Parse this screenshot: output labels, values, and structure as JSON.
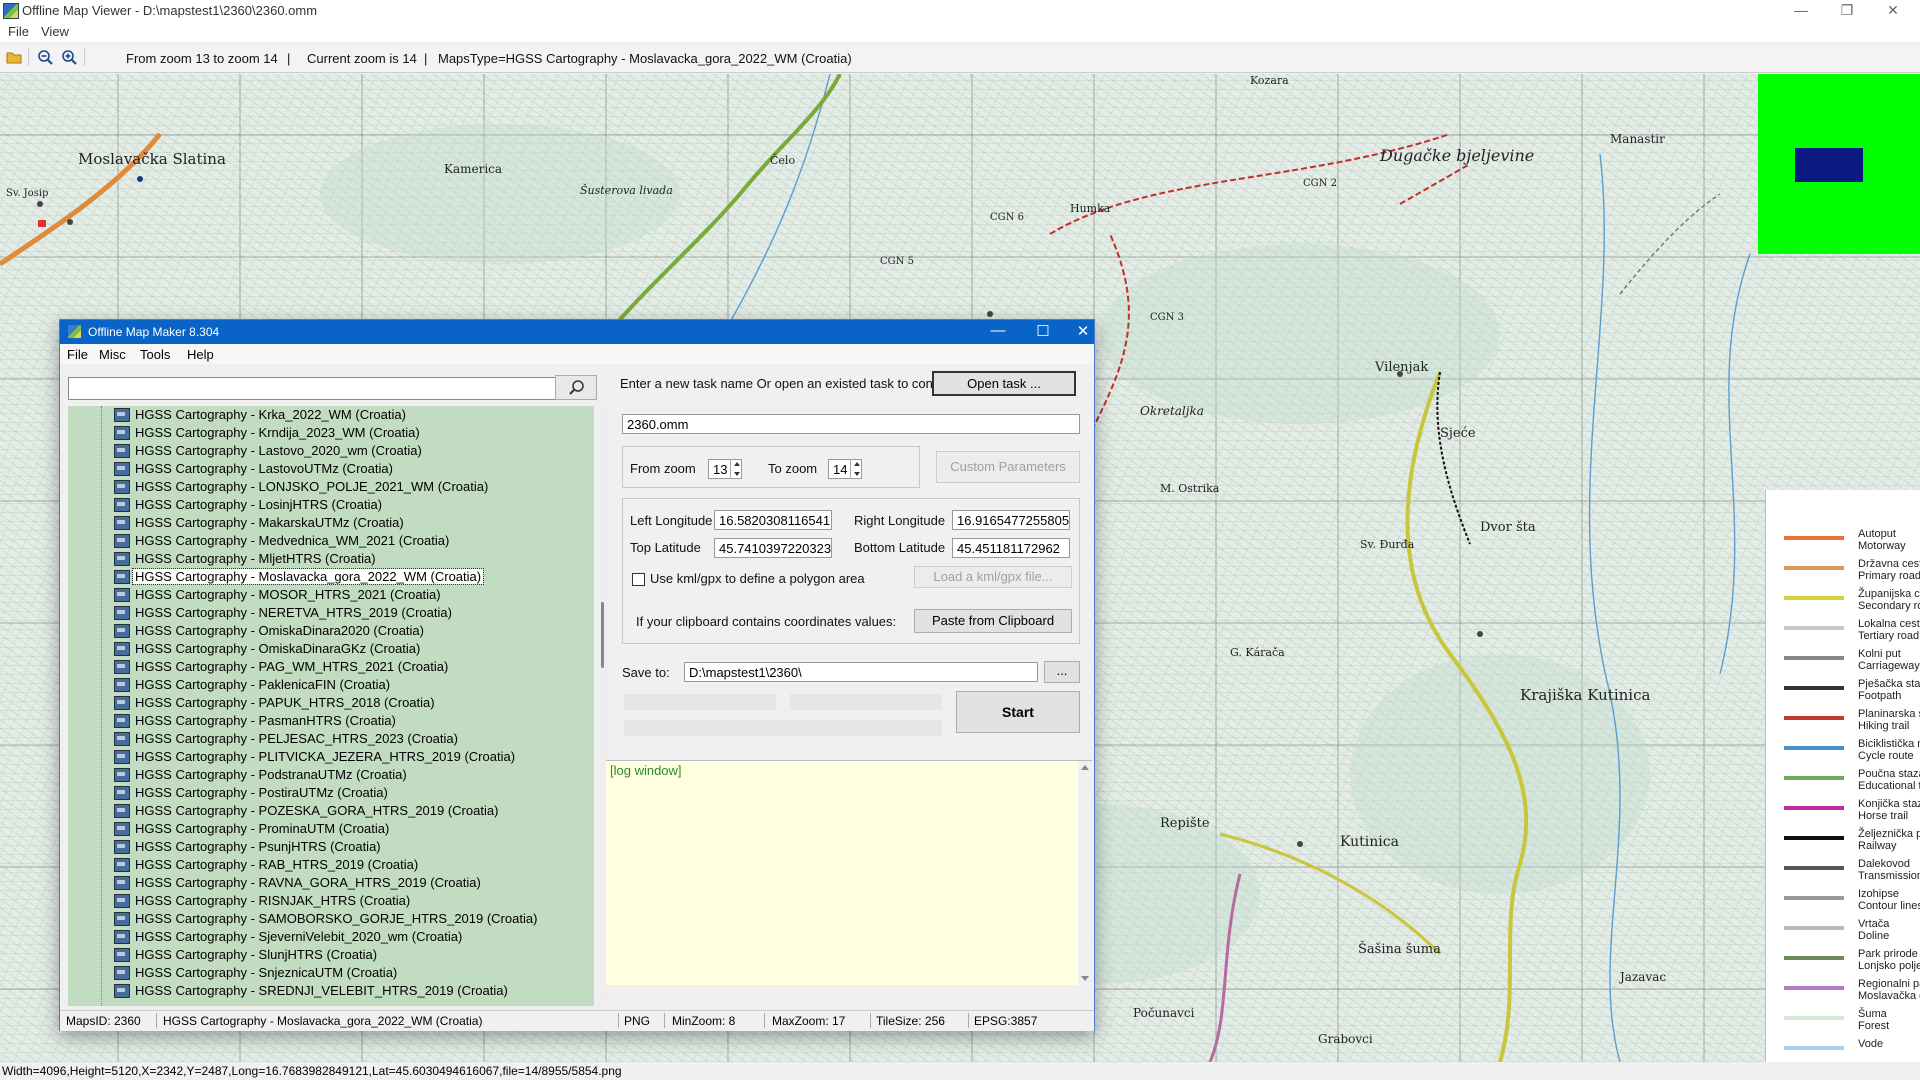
{
  "app": {
    "title": "Offline Map Viewer - D:\\mapstest1\\2360\\2360.omm",
    "menu": [
      "File",
      "View"
    ],
    "controls": [
      "—",
      "❐",
      "✕"
    ]
  },
  "toolbar": {
    "zoom_range": "From zoom 13 to zoom 14",
    "current_zoom": "Current zoom is 14",
    "maps_type": "MapsType=HGSS Cartography - Moslavacka_gora_2022_WM (Croatia)"
  },
  "map": {
    "labels": [
      {
        "text": "Moslavačka Slatina"
      },
      {
        "text": "Kamerica"
      },
      {
        "text": "Šusterova livada"
      },
      {
        "text": "Čelo"
      },
      {
        "text": "Humka"
      },
      {
        "text": "Kozara"
      },
      {
        "text": "Dugačke bjeljevine"
      },
      {
        "text": "Manastir"
      },
      {
        "text": "Vilenjak"
      },
      {
        "text": "Sjeće"
      },
      {
        "text": "Dvor šta"
      },
      {
        "text": "Krajiška Kutinica"
      },
      {
        "text": "Kutinica"
      },
      {
        "text": "Repište"
      },
      {
        "text": "Šašina šuma"
      },
      {
        "text": "Počunavci"
      },
      {
        "text": "Grabovci"
      },
      {
        "text": "Jazavac"
      },
      {
        "text": "Okretaljka"
      },
      {
        "text": "M. Ostrika"
      },
      {
        "text": "Sv. Đurđa"
      },
      {
        "text": "G. Kárača"
      },
      {
        "text": "CGN 2"
      },
      {
        "text": "CGN 3"
      },
      {
        "text": "CGN 5"
      },
      {
        "text": "CGN 6"
      },
      {
        "text": "Sv. Josip"
      }
    ]
  },
  "legend": [
    {
      "text": "Autoput\nMotorway",
      "color": "#e8713a"
    },
    {
      "text": "Državna cest\nPrimary road",
      "color": "#d99a5a"
    },
    {
      "text": "Županijska c\nSecondary ro",
      "color": "#d6d23a"
    },
    {
      "text": "Lokalna cesta\nTertiary road",
      "color": "#c8c8c8"
    },
    {
      "text": "Kolni put\nCarriageway",
      "color": "#888888"
    },
    {
      "text": "Pješačka staz\nFootpath",
      "color": "#333333"
    },
    {
      "text": "Planinarska s\nHiking trail",
      "color": "#c0392b"
    },
    {
      "text": "Biciklistička n\nCycle route",
      "color": "#4a90c8"
    },
    {
      "text": "Poučna staza\nEducational t",
      "color": "#6aaa5a"
    },
    {
      "text": "Konjička staz\nHorse trail",
      "color": "#c02aa0"
    },
    {
      "text": "Željeznička p\nRailway",
      "color": "#111111"
    },
    {
      "text": "Dalekovod\nTransmission",
      "color": "#555555"
    },
    {
      "text": "Izohipse\nContour lines",
      "color": "#999999"
    },
    {
      "text": "Vrtača\nDoline",
      "color": "#bbbbbb"
    },
    {
      "text": "Park prirode l\nLonjsko polje",
      "color": "#6a8a5a"
    },
    {
      "text": "Regionalni pa\nMoslavačka g",
      "color": "#b27bc8"
    },
    {
      "text": "Šuma\nForest",
      "color": "#d5e8d5"
    },
    {
      "text": "Vode",
      "color": "#a8d0e8"
    }
  ],
  "outer_status": "Width=4096,Height=5120,X=2342,Y=2487,Long=16.7683982849121,Lat=45.6030494616067,file=14/8955/5854.png",
  "dialog": {
    "title": "Offline Map Maker 8.304",
    "menu": [
      "File",
      "Misc",
      "Tools",
      "Help"
    ],
    "search_value": "",
    "tree_items": [
      "HGSS Cartography - Krka_2022_WM (Croatia)",
      "HGSS Cartography - Krndija_2023_WM (Croatia)",
      "HGSS Cartography - Lastovo_2020_wm (Croatia)",
      "HGSS Cartography - LastovoUTMz (Croatia)",
      "HGSS Cartography - LONJSKO_POLJE_2021_WM (Croatia)",
      "HGSS Cartography - LosinjHTRS (Croatia)",
      "HGSS Cartography - MakarskaUTMz (Croatia)",
      "HGSS Cartography - Medvednica_WM_2021 (Croatia)",
      "HGSS Cartography - MljetHTRS (Croatia)",
      "HGSS Cartography - Moslavacka_gora_2022_WM (Croatia)",
      "HGSS Cartography - MOSOR_HTRS_2021 (Croatia)",
      "HGSS Cartography - NERETVA_HTRS_2019 (Croatia)",
      "HGSS Cartography - OmiskaDinara2020 (Croatia)",
      "HGSS Cartography - OmiskaDinaraGKz (Croatia)",
      "HGSS Cartography - PAG_WM_HTRS_2021 (Croatia)",
      "HGSS Cartography - PaklenicaFIN (Croatia)",
      "HGSS Cartography - PAPUK_HTRS_2018 (Croatia)",
      "HGSS Cartography - PasmanHTRS (Croatia)",
      "HGSS Cartography - PELJESAC_HTRS_2023 (Croatia)",
      "HGSS Cartography - PLITVICKA_JEZERA_HTRS_2019 (Croatia)",
      "HGSS Cartography - PodstranaUTMz (Croatia)",
      "HGSS Cartography - PostiraUTMz (Croatia)",
      "HGSS Cartography - POZESKA_GORA_HTRS_2019 (Croatia)",
      "HGSS Cartography - ProminaUTM (Croatia)",
      "HGSS Cartography - PsunjHTRS (Croatia)",
      "HGSS Cartography - RAB_HTRS_2019 (Croatia)",
      "HGSS Cartography - RAVNA_GORA_HTRS_2019 (Croatia)",
      "HGSS Cartography - RISNJAK_HTRS (Croatia)",
      "HGSS Cartography - SAMOBORSKO_GORJE_HTRS_2019 (Croatia)",
      "HGSS Cartography - SjeverniVelebit_2020_wm (Croatia)",
      "HGSS Cartography - SlunjHTRS (Croatia)",
      "HGSS Cartography - SnjeznicaUTM (Croatia)",
      "HGSS Cartography - SREDNJI_VELEBIT_HTRS_2019 (Croatia)"
    ],
    "selected_index": 9,
    "task_prompt": "Enter a new task name Or open an existed task to continue:",
    "open_task": "Open task ...",
    "task_name": "2360.omm",
    "from_zoom_label": "From zoom",
    "from_zoom": "13",
    "to_zoom_label": "To zoom",
    "to_zoom": "14",
    "custom_params": "Custom Parameters",
    "left_lon_label": "Left Longitude",
    "left_lon": "16.5820308116541",
    "right_lon_label": "Right Longitude",
    "right_lon": "16.9165477255805",
    "top_lat_label": "Top Latitude",
    "top_lat": "45.7410397220323",
    "bottom_lat_label": "Bottom Latitude",
    "bottom_lat": "45.451181172962",
    "kml_label": "Use kml/gpx to define a polygon area",
    "load_kml": "Load a kml/gpx file...",
    "clipboard_label": "If your clipboard contains coordinates values:",
    "paste_btn": "Paste from Clipboard",
    "save_label": "Save to:",
    "save_path": "D:\\mapstest1\\2360\\",
    "browse": "...",
    "start": "Start",
    "log": "[log window]",
    "status": {
      "maps_id": "MapsID: 2360",
      "maps_name": "HGSS Cartography - Moslavacka_gora_2022_WM (Croatia)",
      "format": "PNG",
      "min_zoom": "MinZoom: 8",
      "max_zoom": "MaxZoom: 17",
      "tile_size": "TileSize: 256",
      "epsg": "EPSG:3857"
    }
  }
}
